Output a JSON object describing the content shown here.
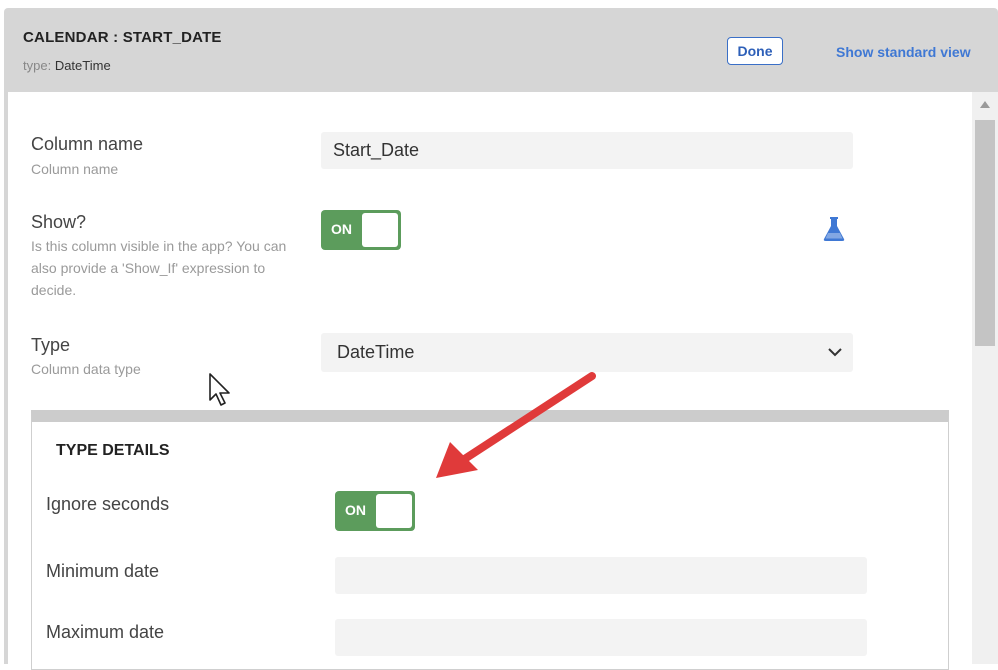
{
  "header": {
    "title": "CALENDAR : START_DATE",
    "type_key": "type:",
    "type_value": "DateTime",
    "done_label": "Done",
    "standard_view_label": "Show standard view"
  },
  "fields": {
    "column_name": {
      "label": "Column name",
      "description": "Column name",
      "value": "Start_Date"
    },
    "show": {
      "label": "Show?",
      "description": "Is this column visible in the app? You can also provide a 'Show_If' expression to decide.",
      "toggle_label": "ON",
      "toggle_state": true
    },
    "type": {
      "label": "Type",
      "description": "Column data type",
      "value": "DateTime"
    }
  },
  "type_details": {
    "title": "TYPE DETAILS",
    "ignore_seconds": {
      "label": "Ignore seconds",
      "toggle_label": "ON",
      "toggle_state": true
    },
    "minimum_date": {
      "label": "Minimum date",
      "value": ""
    },
    "maximum_date": {
      "label": "Maximum date",
      "value": ""
    }
  },
  "colors": {
    "accent": "#3f78d4",
    "toggle_on": "#5c9c5c",
    "annotation_arrow": "#e03a3a"
  },
  "icons": {
    "expression": "flask-icon",
    "dropdown": "chevron-down-icon"
  }
}
